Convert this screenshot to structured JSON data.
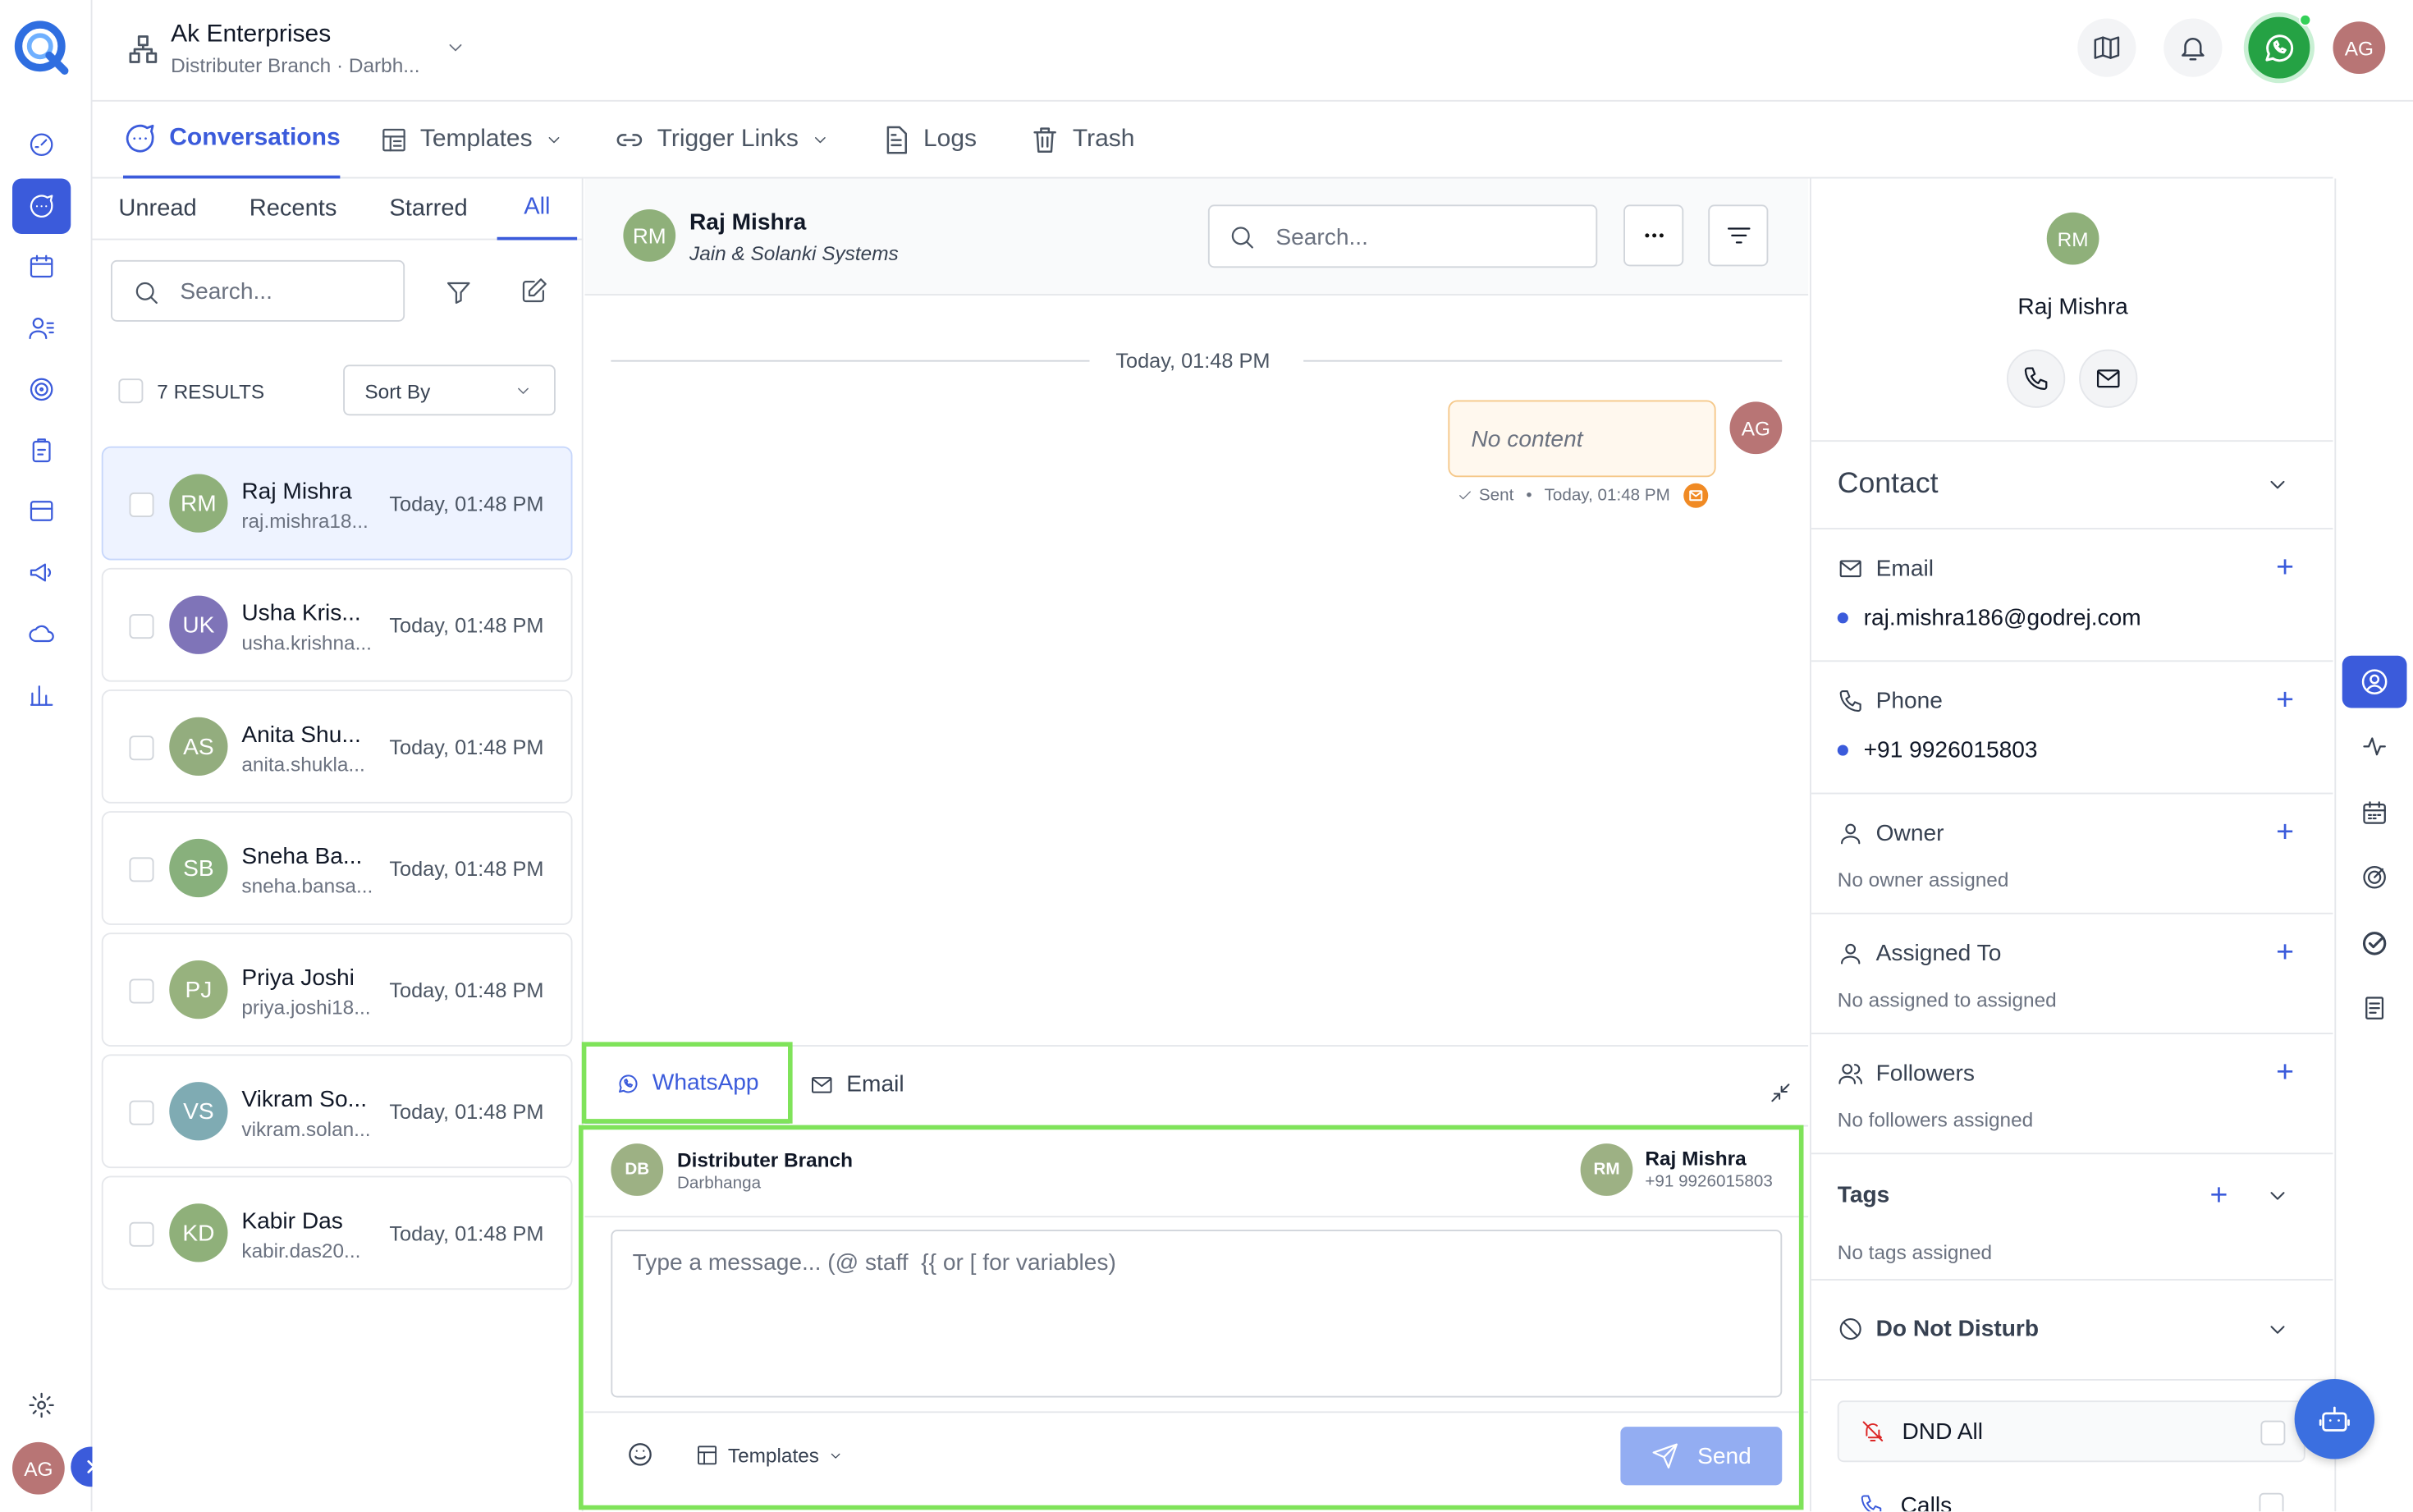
{
  "org": {
    "name": "Ak Enterprises",
    "subtitle": "Distributer Branch · Darbh..."
  },
  "user": {
    "initials": "AG"
  },
  "nav_tabs": [
    {
      "label": "Conversations"
    },
    {
      "label": "Templates"
    },
    {
      "label": "Trigger Links"
    },
    {
      "label": "Logs"
    },
    {
      "label": "Trash"
    }
  ],
  "filter_tabs": [
    "Unread",
    "Recents",
    "Starred",
    "All"
  ],
  "list": {
    "search_placeholder": "Search...",
    "results": "7 RESULTS",
    "sort": "Sort By"
  },
  "conversations": [
    {
      "initials": "RM",
      "name": "Raj Mishra",
      "email": "raj.mishra18...",
      "time": "Today, 01:48 PM",
      "color": "#8fb07a"
    },
    {
      "initials": "UK",
      "name": "Usha Kris...",
      "email": "usha.krishna...",
      "time": "Today, 01:48 PM",
      "color": "#7f74b8"
    },
    {
      "initials": "AS",
      "name": "Anita Shu...",
      "email": "anita.shukla...",
      "time": "Today, 01:48 PM",
      "color": "#93ad7e"
    },
    {
      "initials": "SB",
      "name": "Sneha Ba...",
      "email": "sneha.bansa...",
      "time": "Today, 01:48 PM",
      "color": "#88b07c"
    },
    {
      "initials": "PJ",
      "name": "Priya Joshi",
      "email": "priya.joshi18...",
      "time": "Today, 01:48 PM",
      "color": "#97b27e"
    },
    {
      "initials": "VS",
      "name": "Vikram So...",
      "email": "vikram.solan...",
      "time": "Today, 01:48 PM",
      "color": "#7fabb3"
    },
    {
      "initials": "KD",
      "name": "Kabir Das",
      "email": "kabir.das20...",
      "time": "Today, 01:48 PM",
      "color": "#8fb07a"
    }
  ],
  "chat": {
    "contact_initials": "RM",
    "contact_name": "Raj Mishra",
    "company": "Jain & Solanki Systems",
    "search_placeholder": "Search...",
    "date_divider": "Today, 01:48 PM",
    "message": {
      "text": "No content",
      "status": "Sent",
      "time": "Today, 01:48 PM",
      "sender": "AG"
    },
    "compose_tabs": [
      "WhatsApp",
      "Email"
    ],
    "from": {
      "initials": "DB",
      "name": "Distributer Branch",
      "sub": "Darbhanga"
    },
    "to": {
      "initials": "RM",
      "name": "Raj Mishra",
      "sub": "+91 9926015803"
    },
    "input_placeholder": "Type a message... (@ staff  {{ or [ for variables)",
    "templates_label": "Templates",
    "send_label": "Send"
  },
  "contact_panel": {
    "initials": "RM",
    "name": "Raj Mishra",
    "section_title": "Contact",
    "email_label": "Email",
    "email": "raj.mishra186@godrej.com",
    "phone_label": "Phone",
    "phone": "+91 9926015803",
    "owner_label": "Owner",
    "owner_value": "No owner assigned",
    "assigned_label": "Assigned To",
    "assigned_value": "No assigned to assigned",
    "followers_label": "Followers",
    "followers_value": "No followers assigned",
    "tags_label": "Tags",
    "tags_value": "No tags assigned",
    "dnd_label": "Do Not Disturb",
    "dnd_all": "DND All",
    "calls": "Calls"
  },
  "colors": {
    "accent": "#3b5bdb",
    "whatsapp": "#25a244",
    "highlight": "#7fe35a"
  }
}
